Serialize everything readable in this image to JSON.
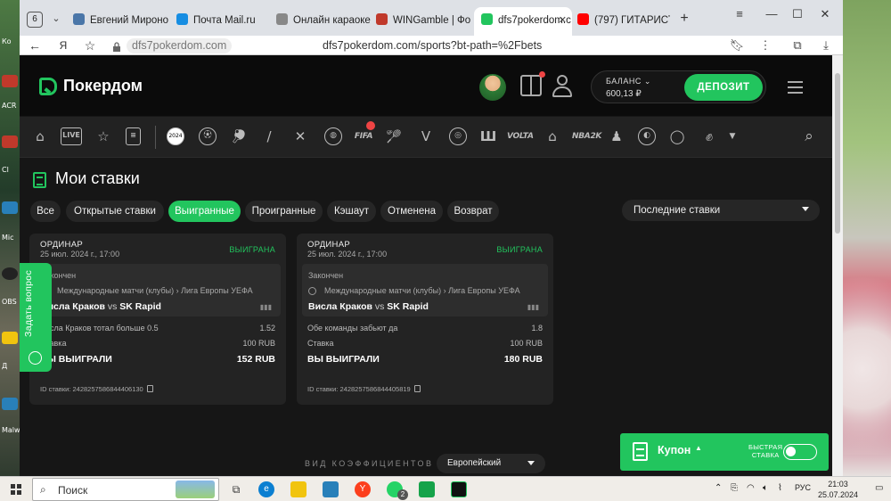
{
  "browser": {
    "tab_count": "6",
    "tabs": [
      {
        "label": "Евгений Мироно",
        "color": "#4a76a8"
      },
      {
        "label": "Почта Mail.ru",
        "color": "#168de2"
      },
      {
        "label": "Онлайн караоке н",
        "color": "#888888"
      },
      {
        "label": "WINGamble | Фор",
        "color": "#c0392b"
      },
      {
        "label": "dfs7pokerdom.c",
        "color": "#22c55e"
      },
      {
        "label": "(797) ГИТАРИСТ",
        "color": "#ff0000"
      }
    ],
    "address_domain": "dfs7pokerdom.com",
    "address_url": "dfs7pokerdom.com/sports?bt-path=%2Fbets"
  },
  "site": {
    "brand": "Покердом",
    "balance_label": "БАЛАНС",
    "balance_value": "600,13 ₽",
    "deposit_label": "ДЕПОЗИТ",
    "sports_icons": [
      "home-icon",
      "live-icon",
      "star-icon",
      "bets-icon",
      "euro-2024-icon",
      "soccer-icon",
      "tennis-icon",
      "hockey-icon",
      "basketball-icon",
      "basketball2-icon",
      "fifa-icon",
      "badminton-icon",
      "valorant-icon",
      "volleyball-icon",
      "nfl-icon",
      "volta-icon",
      "house-icon",
      "nba2k-icon",
      "cs-icon",
      "cricket-icon",
      "pingpong-icon",
      "boxing-icon",
      "more-icon",
      "search-icon"
    ],
    "page_title": "Мои ставки",
    "filters": [
      "Все",
      "Открытые ставки",
      "Выигранные",
      "Проигранные",
      "Кэшаут",
      "Отменена",
      "Возврат"
    ],
    "active_filter": "Выигранные",
    "sort_value": "Последние ставки",
    "ask_question": "Задать вопрос",
    "odds_label": "ВИД КОЭФФИЦИЕНТОВ",
    "odds_value": "Европейский",
    "coupon_label": "Купон",
    "fast_bet": "БЫСТРАЯ\nСТАВКА"
  },
  "bets": [
    {
      "type": "ОРДИНАР",
      "date": "25 июл. 2024 г., 17:00",
      "status": "ВЫИГРАНА",
      "finished": "Закончен",
      "league": "Международные матчи (клубы) › Лига Европы УЕФА",
      "team_home": "Висла Краков",
      "vs": "vs",
      "team_away": "SK Rapid",
      "market": "Висла Краков тотал больше 0.5",
      "odds": "1.52",
      "stake_label": "Ставка",
      "stake": "100 RUB",
      "won_label": "ВЫ ВЫИГРАЛИ",
      "won": "152 RUB",
      "bet_id": "ID ставки: 2428257586844406130"
    },
    {
      "type": "ОРДИНАР",
      "date": "25 июл. 2024 г., 17:00",
      "status": "ВЫИГРАНА",
      "finished": "Закончен",
      "league": "Международные матчи (клубы) › Лига Европы УЕФА",
      "team_home": "Висла Краков",
      "vs": "vs",
      "team_away": "SK Rapid",
      "market": "Обе команды забьют да",
      "odds": "1.8",
      "stake_label": "Ставка",
      "stake": "100 RUB",
      "won_label": "ВЫ ВЫИГРАЛИ",
      "won": "180 RUB",
      "bet_id": "ID ставки: 2428257586844405819"
    }
  ],
  "taskbar": {
    "search_placeholder": "Поиск",
    "lang": "РУС",
    "time": "21:03",
    "date": "25.07.2024",
    "chat_badge": "2"
  },
  "desktop_labels": [
    "Ко",
    "ACR",
    "Cl",
    "Mic",
    "OBS",
    "Д",
    "Malw"
  ]
}
